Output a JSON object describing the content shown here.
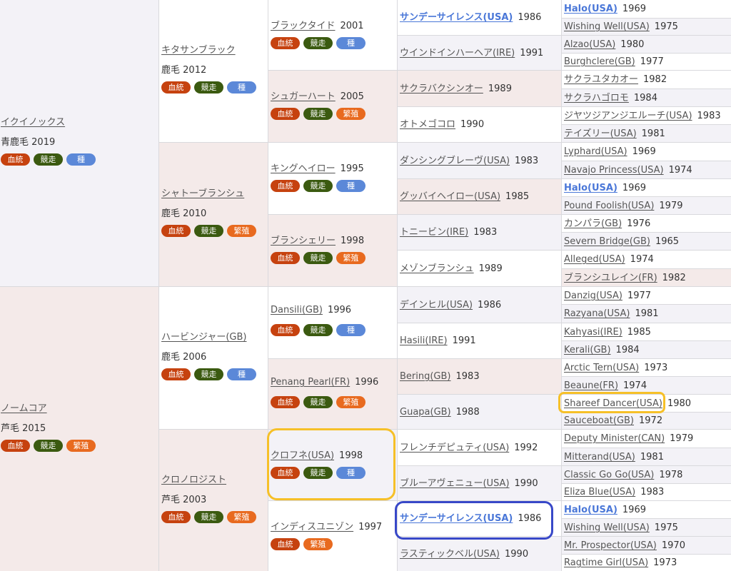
{
  "badge_labels": {
    "kettou": "血統",
    "kyoso": "競走",
    "shu": "種",
    "hanshoku": "繁殖"
  },
  "gen1": [
    {
      "name": "イクイノックス",
      "coat": "青鹿毛",
      "year": "2019"
    },
    {
      "name": "ノームコア",
      "coat": "芦毛",
      "year": "2015"
    }
  ],
  "gen2": [
    {
      "name": "キタサンブラック",
      "coat": "鹿毛",
      "year": "2012"
    },
    {
      "name": "シャトーブランシュ",
      "coat": "鹿毛",
      "year": "2010"
    },
    {
      "name": "ハービンジャー(GB)",
      "coat": "鹿毛",
      "year": "2006"
    },
    {
      "name": "クロノロジスト",
      "coat": "芦毛",
      "year": "2003"
    }
  ],
  "gen3": [
    {
      "name": "ブラックタイド",
      "year": "2001"
    },
    {
      "name": "シュガーハート",
      "year": "2005"
    },
    {
      "name": "キングヘイロー",
      "year": "1995"
    },
    {
      "name": "ブランシェリー",
      "year": "1998"
    },
    {
      "name": "Dansili(GB)",
      "year": "1996"
    },
    {
      "name": "Penang Pearl(FR)",
      "year": "1996"
    },
    {
      "name": "クロフネ(USA)",
      "year": "1998"
    },
    {
      "name": "インディスユニゾン",
      "year": "1997"
    }
  ],
  "gen4": [
    {
      "name": "サンデーサイレンス(USA)",
      "year": "1986"
    },
    {
      "name": "ウインドインハーヘア(IRE)",
      "year": "1991"
    },
    {
      "name": "サクラバクシンオー",
      "year": "1989"
    },
    {
      "name": "オトメゴコロ",
      "year": "1990"
    },
    {
      "name": "ダンシングブレーヴ(USA)",
      "year": "1983"
    },
    {
      "name": "グッバイヘイロー(USA)",
      "year": "1985"
    },
    {
      "name": "トニービン(IRE)",
      "year": "1983"
    },
    {
      "name": "メゾンブランシュ",
      "year": "1989"
    },
    {
      "name": "デインヒル(USA)",
      "year": "1986"
    },
    {
      "name": "Hasili(IRE)",
      "year": "1991"
    },
    {
      "name": "Bering(GB)",
      "year": "1983"
    },
    {
      "name": "Guapa(GB)",
      "year": "1988"
    },
    {
      "name": "フレンチデピュティ(USA)",
      "year": "1992"
    },
    {
      "name": "ブルーアヴェニュー(USA)",
      "year": "1990"
    },
    {
      "name": "サンデーサイレンス(USA)",
      "year": "1986"
    },
    {
      "name": "ラスティックベル(USA)",
      "year": "1990"
    }
  ],
  "gen5": [
    {
      "name": "Halo(USA)",
      "year": "1969"
    },
    {
      "name": "Wishing Well(USA)",
      "year": "1975"
    },
    {
      "name": "Alzao(USA)",
      "year": "1980"
    },
    {
      "name": "Burghclere(GB)",
      "year": "1977"
    },
    {
      "name": "サクラユタカオー",
      "year": "1982"
    },
    {
      "name": "サクラハゴロモ",
      "year": "1984"
    },
    {
      "name": "ジヤツジアンジエルーチ(USA)",
      "year": "1983"
    },
    {
      "name": "テイズリー(USA)",
      "year": "1981"
    },
    {
      "name": "Lyphard(USA)",
      "year": "1969"
    },
    {
      "name": "Navajo Princess(USA)",
      "year": "1974"
    },
    {
      "name": "Halo(USA)",
      "year": "1969"
    },
    {
      "name": "Pound Foolish(USA)",
      "year": "1979"
    },
    {
      "name": "カンパラ(GB)",
      "year": "1976"
    },
    {
      "name": "Severn Bridge(GB)",
      "year": "1965"
    },
    {
      "name": "Alleged(USA)",
      "year": "1974"
    },
    {
      "name": "ブランシユレイン(FR)",
      "year": "1982"
    },
    {
      "name": "Danzig(USA)",
      "year": "1977"
    },
    {
      "name": "Razyana(USA)",
      "year": "1981"
    },
    {
      "name": "Kahyasi(IRE)",
      "year": "1985"
    },
    {
      "name": "Kerali(GB)",
      "year": "1984"
    },
    {
      "name": "Arctic Tern(USA)",
      "year": "1973"
    },
    {
      "name": "Beaune(FR)",
      "year": "1974"
    },
    {
      "name": "Shareef Dancer(USA)",
      "year": "1980"
    },
    {
      "name": "Sauceboat(GB)",
      "year": "1972"
    },
    {
      "name": "Deputy Minister(CAN)",
      "year": "1979"
    },
    {
      "name": "Mitterand(USA)",
      "year": "1981"
    },
    {
      "name": "Classic Go Go(USA)",
      "year": "1978"
    },
    {
      "name": "Eliza Blue(USA)",
      "year": "1983"
    },
    {
      "name": "Halo(USA)",
      "year": "1969"
    },
    {
      "name": "Wishing Well(USA)",
      "year": "1975"
    },
    {
      "name": "Mr. Prospector(USA)",
      "year": "1970"
    },
    {
      "name": "Ragtime Girl(USA)",
      "year": "1973"
    }
  ]
}
